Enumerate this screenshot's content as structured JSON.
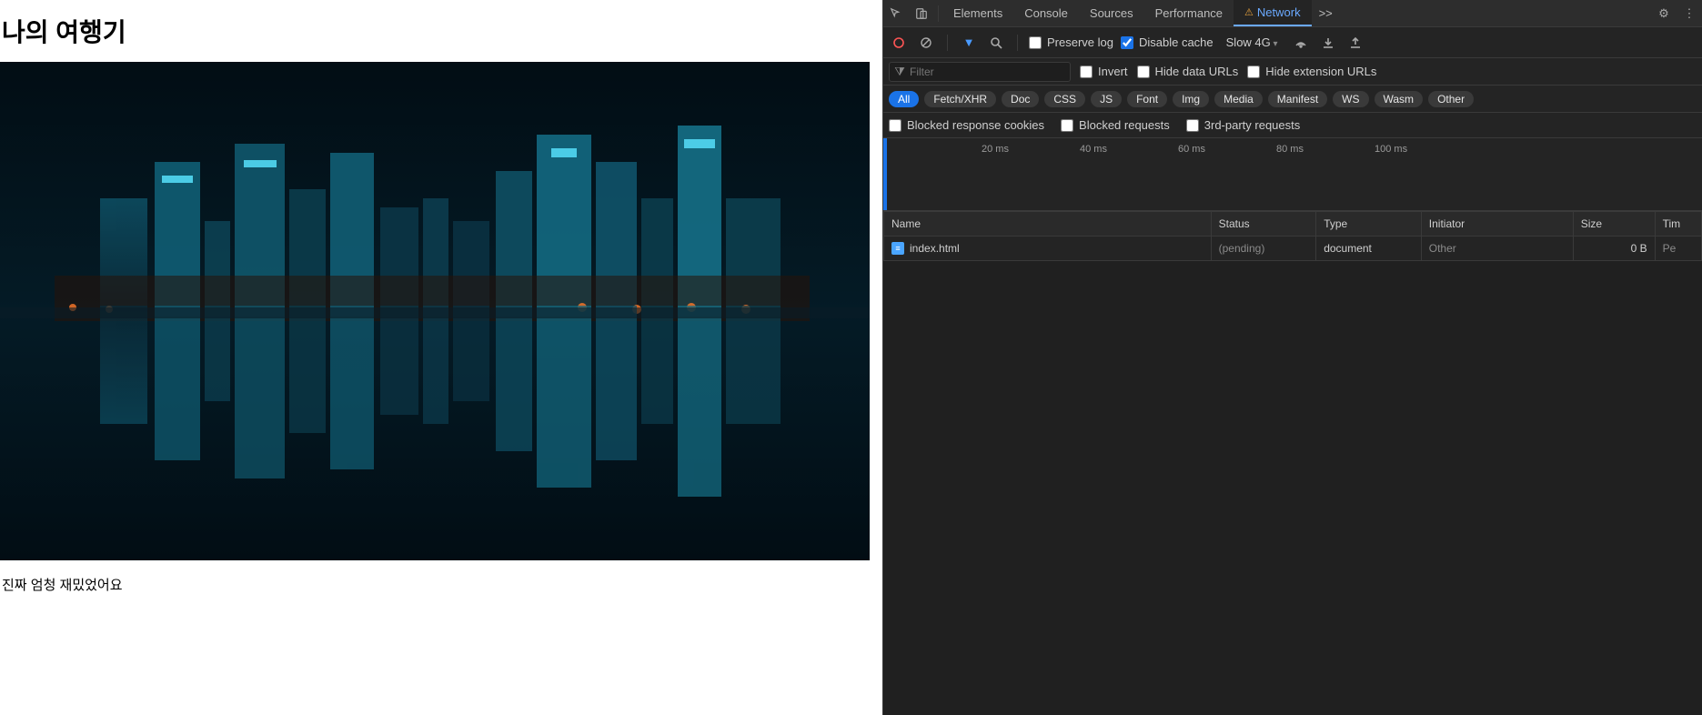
{
  "page": {
    "title": "나의 여행기",
    "caption": "진짜 엄청 재밌었어요"
  },
  "devtools": {
    "tabs": [
      "Elements",
      "Console",
      "Sources",
      "Performance",
      "Network"
    ],
    "activeTab": "Network",
    "more": ">>",
    "toolbar": {
      "preserve": "Preserve log",
      "disableCache": "Disable cache",
      "throttle": "Slow 4G"
    },
    "filter": {
      "placeholder": "Filter",
      "invert": "Invert",
      "hideData": "Hide data URLs",
      "hideExt": "Hide extension URLs"
    },
    "pills": [
      "All",
      "Fetch/XHR",
      "Doc",
      "CSS",
      "JS",
      "Font",
      "Img",
      "Media",
      "Manifest",
      "WS",
      "Wasm",
      "Other"
    ],
    "activePill": "All",
    "row4": {
      "blockedCookies": "Blocked response cookies",
      "blockedReq": "Blocked requests",
      "thirdParty": "3rd-party requests"
    },
    "timeline": [
      {
        "label": "20 ms",
        "pct": 12
      },
      {
        "label": "40 ms",
        "pct": 24
      },
      {
        "label": "60 ms",
        "pct": 36
      },
      {
        "label": "80 ms",
        "pct": 48
      },
      {
        "label": "100 ms",
        "pct": 60
      }
    ],
    "grid": {
      "cols": [
        "Name",
        "Status",
        "Type",
        "Initiator",
        "Size",
        "Tim"
      ],
      "rows": [
        {
          "name": "index.html",
          "status": "(pending)",
          "type": "document",
          "initiator": "Other",
          "size": "0 B",
          "time": "Pe"
        }
      ]
    }
  }
}
